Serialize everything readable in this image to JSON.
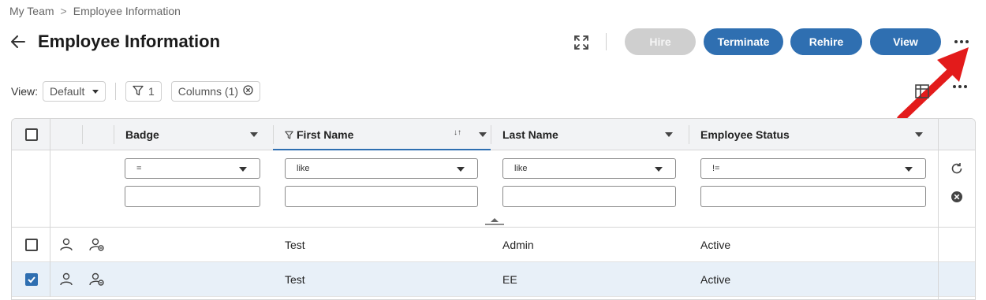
{
  "breadcrumb": {
    "parent": "My Team",
    "separator": ">",
    "current": "Employee Information"
  },
  "page": {
    "title": "Employee Information"
  },
  "actions": {
    "hire": "Hire",
    "terminate": "Terminate",
    "rehire": "Rehire",
    "view": "View"
  },
  "toolbar": {
    "view_label": "View:",
    "view_value": "Default",
    "filter_count": "1",
    "columns_label": "Columns (1)"
  },
  "table": {
    "columns": [
      "Badge",
      "First Name",
      "Last Name",
      "Employee Status"
    ],
    "filters": {
      "badge_op": "=",
      "first_name_op": "like",
      "last_name_op": "like",
      "status_op": "!="
    },
    "rows": [
      {
        "badge": "",
        "first_name": "Test",
        "last_name": "Admin",
        "status": "Active",
        "selected": false
      },
      {
        "badge": "",
        "first_name": "Test",
        "last_name": "EE",
        "status": "Active",
        "selected": true
      }
    ]
  },
  "colors": {
    "primary": "#2f6fb1",
    "disabled": "#cfcfcf",
    "annotation_arrow": "#e31b1b",
    "selected_row": "#e8f0f8"
  },
  "icons": [
    "back-arrow-icon",
    "expand-icon",
    "more-horizontal-icon",
    "dropdown-caret-icon",
    "filter-icon",
    "clear-circle-icon",
    "table-settings-icon",
    "sort-icon",
    "refresh-icon",
    "user-icon",
    "user-link-icon",
    "checkmark-icon"
  ]
}
